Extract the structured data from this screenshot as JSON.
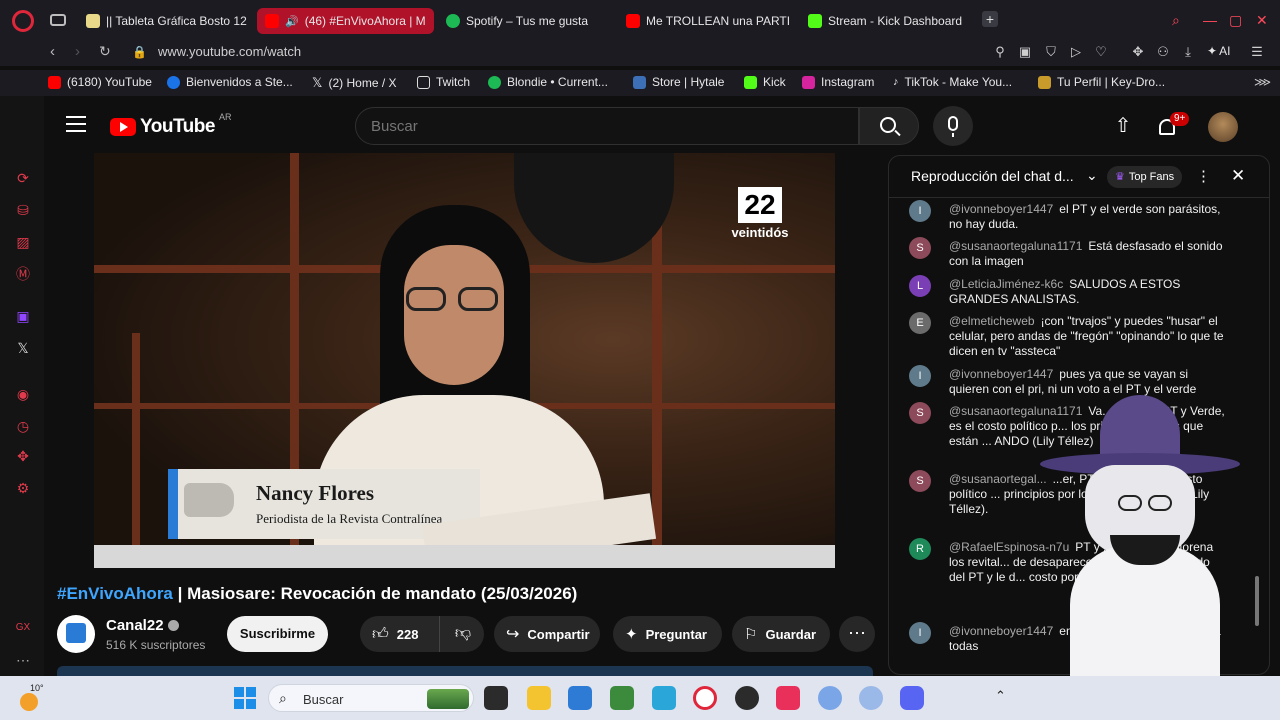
{
  "browser": {
    "tabs": [
      {
        "label": "|| Tableta Gráfica Bosto 12",
        "color": "#e8d98a"
      },
      {
        "label": "(46) #EnVivoAhora | M",
        "color": "#ff0000",
        "active": true
      },
      {
        "label": "Spotify – Tus me gusta",
        "color": "#1db954"
      },
      {
        "label": "Me TROLLEAN una PARTI",
        "color": "#ff0000"
      },
      {
        "label": "Stream - Kick Dashboard",
        "color": "#53fc18"
      }
    ],
    "new_tab": "+",
    "url": "www.youtube.com/watch",
    "ai_label": "AI",
    "bookmarks": [
      {
        "label": "(6180) YouTube",
        "color": "#ff0000"
      },
      {
        "label": "Bienvenidos a Ste...",
        "color": "#1b73e8"
      },
      {
        "label": "(2) Home / X",
        "color": "#000000"
      },
      {
        "label": "Twitch",
        "color": "#ffffff"
      },
      {
        "label": "Blondie • Current...",
        "color": "#1db954"
      },
      {
        "label": "Store | Hytale",
        "color": "#3c6fb5"
      },
      {
        "label": "Kick",
        "color": "#53fc18"
      },
      {
        "label": "Instagram",
        "color": "#d6249f"
      },
      {
        "label": "TikTok - Make You...",
        "color": "#111111"
      },
      {
        "label": "Tu Perfil | Key-Dro...",
        "color": "#c89b2a"
      }
    ]
  },
  "youtube": {
    "logo_text": "YouTube",
    "region": "AR",
    "search_placeholder": "Buscar",
    "notification_count": "9+",
    "video": {
      "channel_logo_number": "22",
      "channel_logo_word": "veintidós",
      "lower_third_name": "Nancy Flores",
      "lower_third_role": "Periodista de la Revista Contralínea"
    },
    "title_hashtag": "#EnVivoAhora",
    "title_rest": " | Masiosare: Revocación de mandato (25/03/2026)",
    "channel_name": "Canal22",
    "subscribers": "516 K suscriptores",
    "subscribe_label": "Suscribirme",
    "like_count": "228",
    "share_label": "Compartir",
    "ask_label": "Preguntar",
    "save_label": "Guardar"
  },
  "chat": {
    "header_title": "Reproducción del chat d...",
    "top_fans": "Top Fans",
    "messages": [
      {
        "author": "@ivonneboyer1447",
        "text": "el PT y el verde son parásitos, no hay duda.",
        "initial": "I",
        "color": "#5f7a8a"
      },
      {
        "author": "@susanaortegaluna1171",
        "text": "Está desfasado el sonido con la imagen",
        "initial": "S",
        "color": "#8c4a5a"
      },
      {
        "author": "@LeticiaJiménez-k6c",
        "text": "SALUDOS A ESTOS GRANDES ANALISTAS.",
        "initial": "L",
        "color": "#7b3fb5"
      },
      {
        "author": "@elmeticheweb",
        "text": "¡con \"trvajos\" y puedes \"husar\" el celular, pero andas de \"fregón\" \"opinando\" lo que te dicen en tv \"assteca\"",
        "initial": "E",
        "color": "#6b6b6b"
      },
      {
        "author": "@ivonneboyer1447",
        "text": "pues ya que se vayan si quieren con el pri, ni un voto a el PT y el verde",
        "initial": "I",
        "color": "#5f7a8a"
      },
      {
        "author": "@susanaortegaluna1171",
        "text": "Va... parecer, PT y Verde, es el costo político p... los principios por los que están ... ANDO (Lily Téllez)",
        "initial": "S",
        "color": "#8c4a5a"
      },
      {
        "author": "@susanaortegal...",
        "text": "...er, PT y Verde, es el costo político ... principios por los que est... ANDO (Lily Téllez).",
        "initial": "S",
        "color": "#8c4a5a"
      },
      {
        "author": "@RafaelEspinosa-n7u",
        "text": "PT y ... son nada, Morena los revital... de desaparecer y AMLO l... Diputado del PT y le d... costo por apoyarlos.",
        "initial": "R",
        "color": "#1e8a5a"
      },
      {
        "author": "@ivonneboyer1447",
        "text": "en este horario pe... saludos a todas",
        "initial": "I",
        "color": "#5f7a8a"
      }
    ]
  },
  "taskbar": {
    "search_placeholder": "Buscar",
    "temperature": "10°"
  }
}
